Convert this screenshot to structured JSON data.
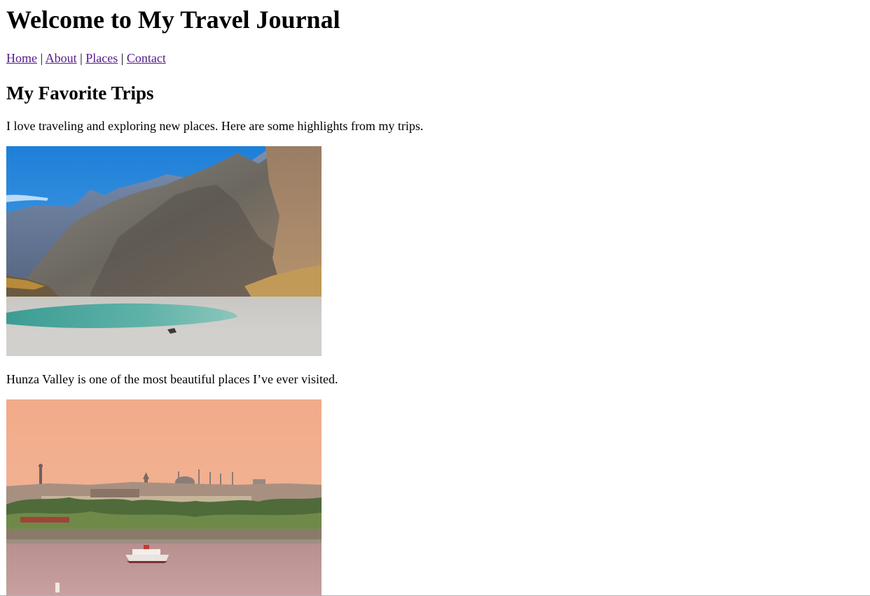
{
  "header": {
    "title": "Welcome to My Travel Journal"
  },
  "nav": {
    "items": [
      {
        "label": "Home"
      },
      {
        "label": "About"
      },
      {
        "label": "Places"
      },
      {
        "label": "Contact"
      }
    ],
    "separator": "|"
  },
  "main": {
    "section_title": "My Favorite Trips",
    "intro": "I love traveling and exploring new places. Here are some highlights from my trips.",
    "photos": [
      {
        "icon": "mountain-valley-photo"
      },
      {
        "icon": "city-waterfront-sunset-photo"
      }
    ],
    "captions": [
      "Hunza Valley is one of the most beautiful places I’ve ever visited."
    ]
  },
  "colors": {
    "link_visited": "#551a8b",
    "text": "#000000",
    "background": "#ffffff"
  }
}
